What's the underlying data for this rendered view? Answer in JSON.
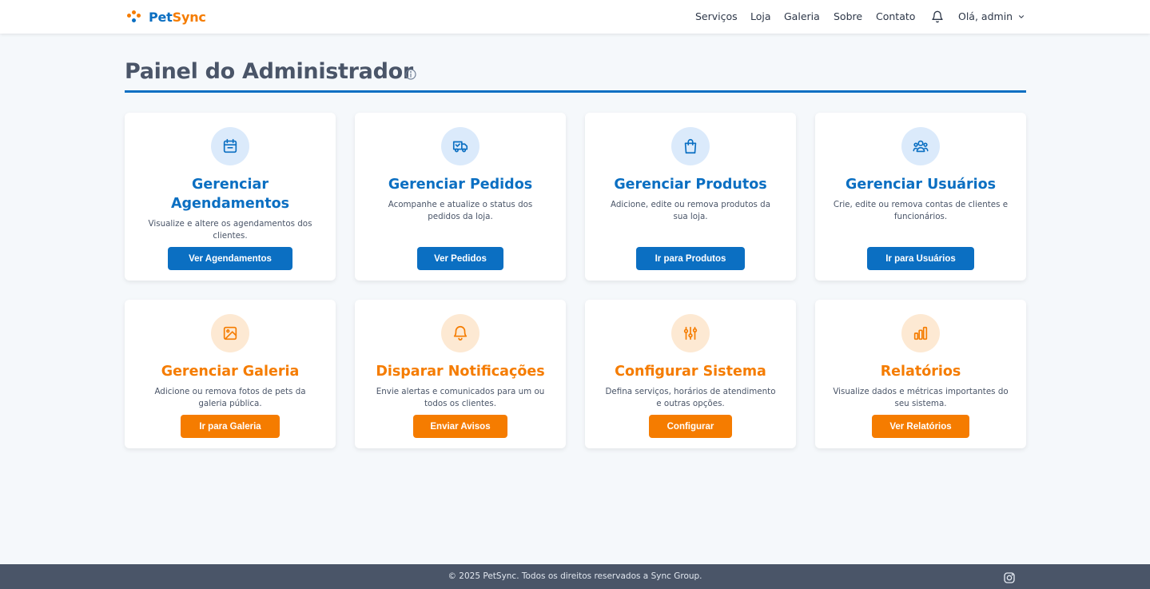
{
  "brand": {
    "name_part1": "Pet",
    "name_part2": "Sync"
  },
  "nav": {
    "links": [
      "Serviços",
      "Loja",
      "Galeria",
      "Sobre",
      "Contato"
    ],
    "user_greeting": "Olá, admin"
  },
  "page": {
    "title": "Painel do Administrador"
  },
  "cards": [
    {
      "title": "Gerenciar Agendamentos",
      "description": "Visualize e altere os agendamentos dos clientes.",
      "button": "Ver Agendamentos",
      "icon": "calendar-icon",
      "theme": "blue"
    },
    {
      "title": "Gerenciar Pedidos",
      "description": "Acompanhe e atualize o status dos pedidos da loja.",
      "button": "Ver Pedidos",
      "icon": "truck-icon",
      "theme": "blue"
    },
    {
      "title": "Gerenciar Produtos",
      "description": "Adicione, edite ou remova produtos da sua loja.",
      "button": "Ir para Produtos",
      "icon": "shopping-bag-icon",
      "theme": "blue"
    },
    {
      "title": "Gerenciar Usuários",
      "description": "Crie, edite ou remova contas de clientes e funcionários.",
      "button": "Ir para Usuários",
      "icon": "users-icon",
      "theme": "blue"
    },
    {
      "title": "Gerenciar Galeria",
      "description": "Adicione ou remova fotos de pets da galeria pública.",
      "button": "Ir para Galeria",
      "icon": "image-icon",
      "theme": "orange"
    },
    {
      "title": "Disparar Notificações",
      "description": "Envie alertas e comunicados para um ou todos os clientes.",
      "button": "Enviar Avisos",
      "icon": "bell-icon",
      "theme": "orange"
    },
    {
      "title": "Configurar Sistema",
      "description": "Defina serviços, horários de atendimento e outras opções.",
      "button": "Configurar",
      "icon": "sliders-icon",
      "theme": "orange"
    },
    {
      "title": "Relatórios",
      "description": "Visualize dados e métricas importantes do seu sistema.",
      "button": "Ver Relatórios",
      "icon": "bar-chart-icon",
      "theme": "orange"
    }
  ],
  "footer": {
    "text": "© 2025 PetSync. Todos os direitos reservados a Sync Group."
  },
  "colors": {
    "primary_blue": "#0b6fc2",
    "accent_orange": "#f57c00",
    "footer_bg": "#4a5568",
    "page_bg": "#f5f8fb"
  }
}
